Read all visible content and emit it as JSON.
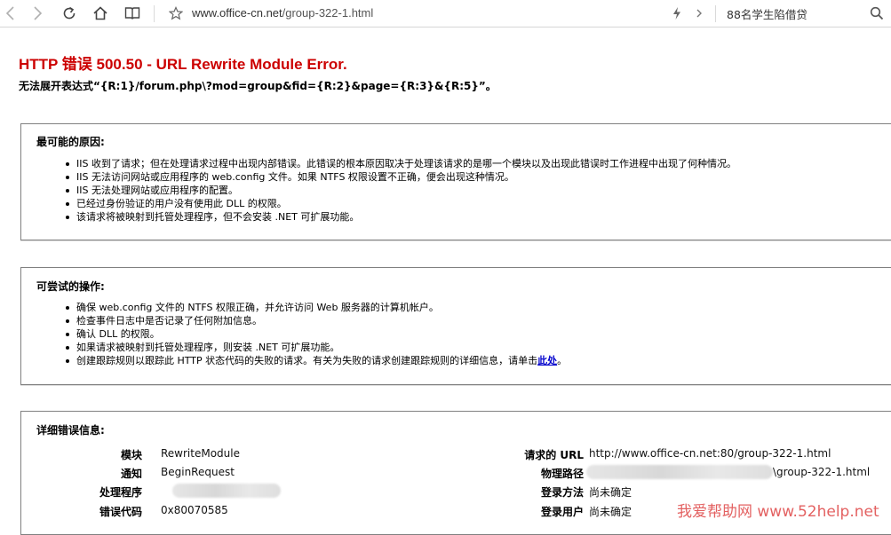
{
  "browser": {
    "url_host": "www.office-cn.net",
    "url_path": "/group-322-1.html",
    "search_text": "88名学生陷借贷"
  },
  "page": {
    "title": "HTTP 错误 500.50 - URL Rewrite Module Error.",
    "subtitle": "无法展开表达式“{R:1}/forum.php\\?mod=group&fid={R:2}&page={R:3}&{R:5}”。"
  },
  "causes": {
    "heading": "最可能的原因:",
    "items": [
      "IIS 收到了请求；但在处理请求过程中出现内部错误。此错误的根本原因取决于处理该请求的是哪一个模块以及出现此错误时工作进程中出现了何种情况。",
      "IIS 无法访问网站或应用程序的 web.config 文件。如果 NTFS 权限设置不正确，便会出现这种情况。",
      "IIS 无法处理网站或应用程序的配置。",
      "已经过身份验证的用户没有使用此 DLL 的权限。",
      "该请求将被映射到托管处理程序，但不会安装 .NET 可扩展功能。"
    ]
  },
  "actions": {
    "heading": "可尝试的操作:",
    "items": [
      "确保 web.config 文件的 NTFS 权限正确，并允许访问 Web 服务器的计算机帐户。",
      "检查事件日志中是否记录了任何附加信息。",
      "确认 DLL 的权限。",
      "如果请求被映射到托管处理程序，则安装 .NET 可扩展功能。"
    ],
    "last_item_text": "创建跟踪规则以跟踪此 HTTP 状态代码的失败的请求。有关为失败的请求创建跟踪规则的详细信息，请单击",
    "last_item_link": "此处",
    "last_item_end": "。"
  },
  "details": {
    "heading": "详细错误信息:",
    "left": [
      {
        "label": "模块",
        "value": "RewriteModule"
      },
      {
        "label": "通知",
        "value": "BeginRequest"
      },
      {
        "label": "处理程序",
        "value": ""
      },
      {
        "label": "错误代码",
        "value": "0x80070585"
      }
    ],
    "right": [
      {
        "label": "请求的 URL",
        "value": "http://www.office-cn.net:80/group-322-1.html"
      },
      {
        "label": "物理路径",
        "value": "\\group-322-1.html"
      },
      {
        "label": "登录方法",
        "value": "尚未确定"
      },
      {
        "label": "登录用户",
        "value": "尚未确定"
      }
    ]
  },
  "watermark": "我爱帮助网 www.52help.net"
}
